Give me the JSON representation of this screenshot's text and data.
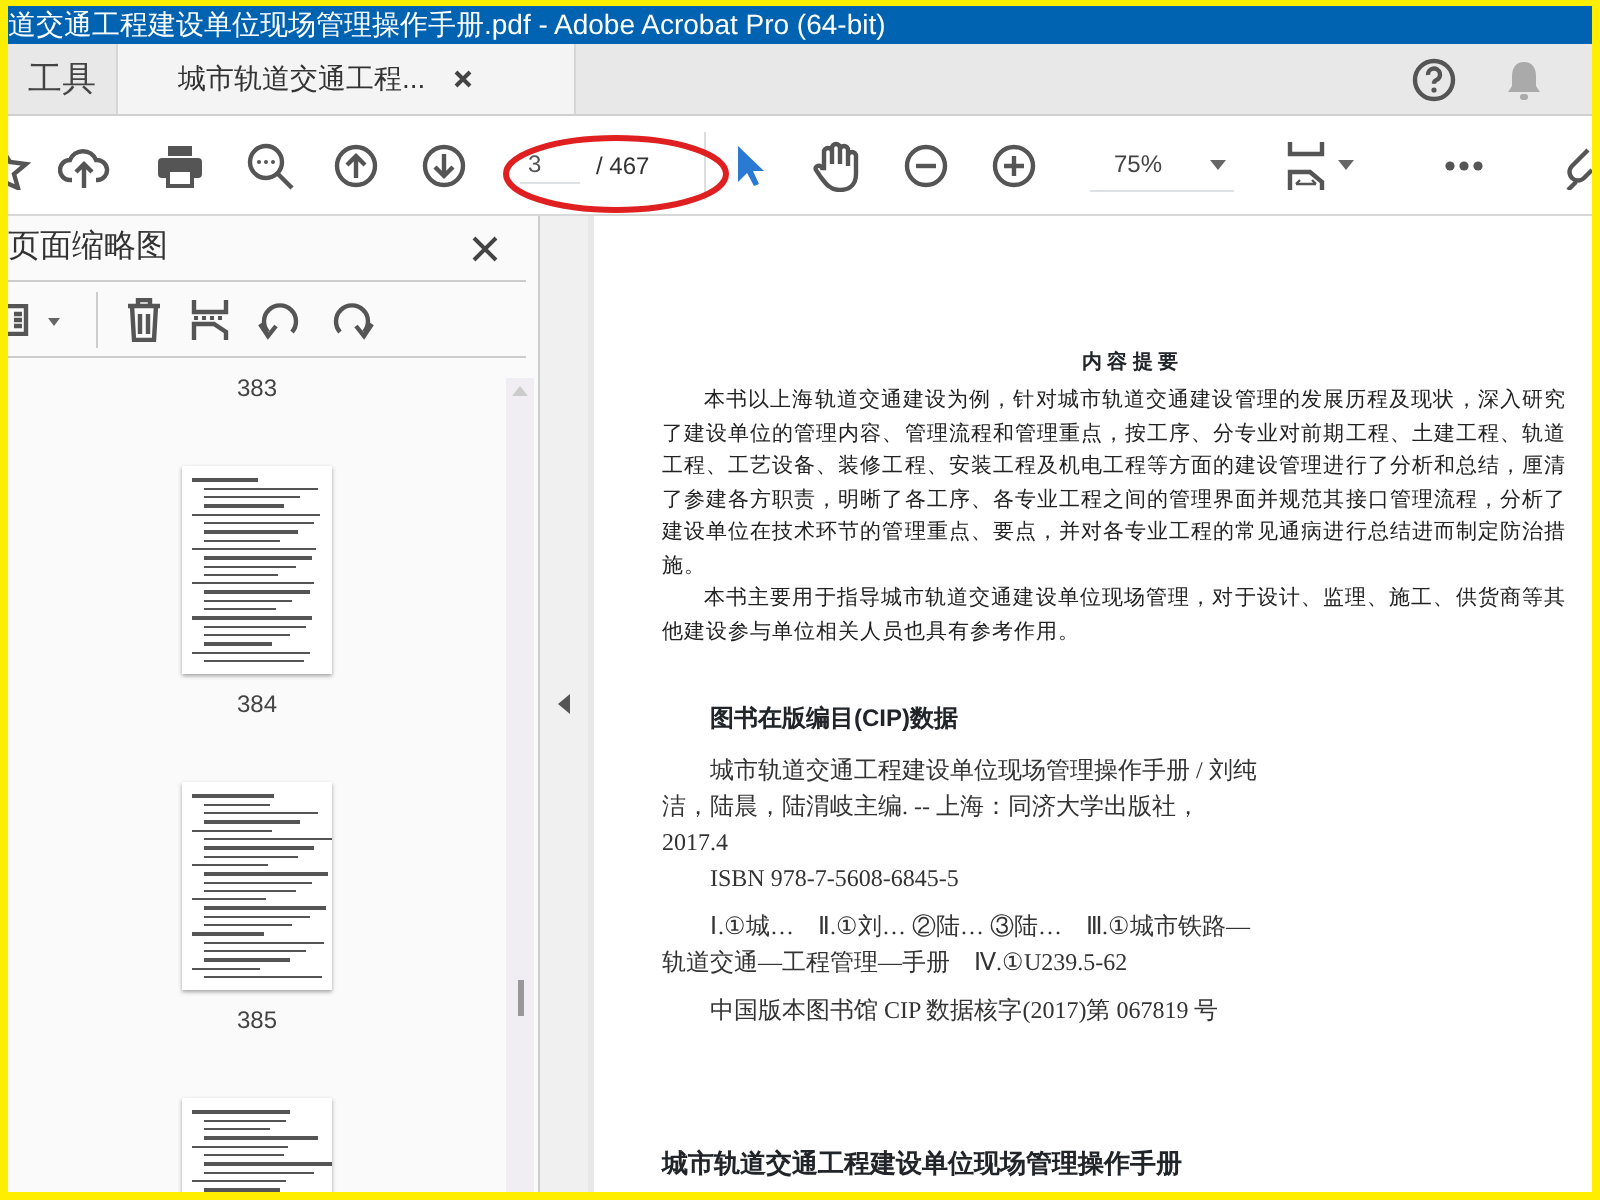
{
  "window": {
    "title": "道交通工程建设单位现场管理操作手册.pdf - Adobe Acrobat Pro (64-bit)"
  },
  "tabs": [
    {
      "label": "工具",
      "selected": false
    },
    {
      "label": "城市轨道交通工程...",
      "selected": true
    }
  ],
  "toolbar": {
    "page_number": "3",
    "page_total": "/ 467",
    "zoom": "75%"
  },
  "thumbnail_panel": {
    "title": "页面缩略图",
    "page_labels": [
      "383",
      "384",
      "385"
    ]
  },
  "document": {
    "abstract_heading": "内 容 提 要",
    "abstract": [
      "本书以上海轨道交通建设为例，针对城市轨道交通建设管理的发展历程及现状，深入研究了建设单位的管理内容、管理流程和管理重点，按工序、分专业对前期工程、土建工程、轨道工程、工艺设备、装修工程、安装工程及机电工程等方面的建设管理进行了分析和总结，厘清了参建各方职责，明晰了各工序、各专业工程之间的管理界面并规范其接口管理流程，分析了建设单位在技术环节的管理重点、要点，并对各专业工程的常见通病进行总结进而制定防治措施。",
      "本书主要用于指导城市轨道交通建设单位现场管理，对于设计、监理、施工、供货商等其他建设参与单位相关人员也具有参考作用。"
    ],
    "cip_heading": "图书在版编目(CIP)数据",
    "cip_lines": [
      "城市轨道交通工程建设单位现场管理操作手册 / 刘纯洁，陆晨，陆渭岐主编. -- 上海：同济大学出版社，2017.4",
      "ISBN 978-7-5608-6845-5",
      "Ⅰ.①城…　Ⅱ.①刘…  ②陆…  ③陆…　Ⅲ.①城市铁路—轨道交通—工程管理—手册　Ⅳ.①U239.5-62",
      "中国版本图书馆 CIP 数据核字(2017)第 067819 号"
    ],
    "book_title": "城市轨道交通工程建设单位现场管理操作手册"
  }
}
